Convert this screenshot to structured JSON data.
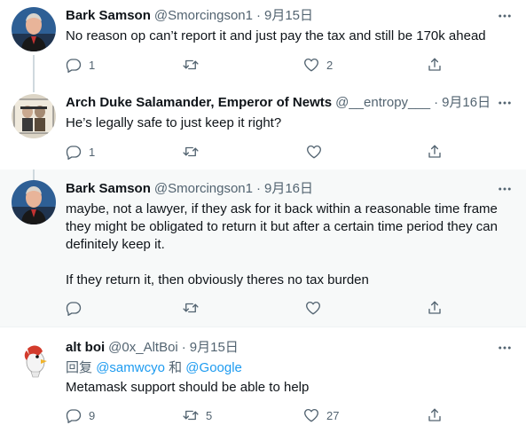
{
  "tweets": [
    {
      "name": "Bark Samson",
      "handle": "@Smorcingson1",
      "date": "9月15日",
      "text": "No reason op can’t report it and just pay the tax and still be 170k ahead",
      "replies": "1",
      "retweets": "",
      "likes": "2"
    },
    {
      "name": "Arch Duke Salamander, Emperor of Newts",
      "handle": "@__entropy___",
      "date": "9月16日",
      "text": "He’s legally safe to just keep it right?",
      "replies": "1",
      "retweets": "",
      "likes": ""
    },
    {
      "name": "Bark Samson",
      "handle": "@Smorcingson1",
      "date": "9月16日",
      "text_p1": "maybe, not a lawyer, if they ask for it back within a reasonable time frame they might be obligated to return it but after a certain time period they can definitely keep it.",
      "text_p2": "If they return it, then obviously theres no tax burden",
      "replies": "",
      "retweets": "",
      "likes": ""
    },
    {
      "name": "alt boi",
      "handle": "@0x_AltBoi",
      "date": "9月15日",
      "reply_prefix": "回复",
      "reply_user1": "@samwcyo",
      "reply_and": "和",
      "reply_user2": "@Google",
      "text": "Metamask support should be able to help",
      "replies": "9",
      "retweets": "5",
      "likes": "27"
    }
  ],
  "separator": "·",
  "icons": {
    "reply": "reply-icon",
    "retweet": "retweet-icon",
    "like": "heart-icon",
    "share": "share-icon",
    "more": "more-icon"
  },
  "colors": {
    "text": "#0f1419",
    "secondary": "#536471",
    "link": "#1d9bf0",
    "highlight_bg": "#f7f9f9",
    "thread_line": "#cfd9de"
  }
}
